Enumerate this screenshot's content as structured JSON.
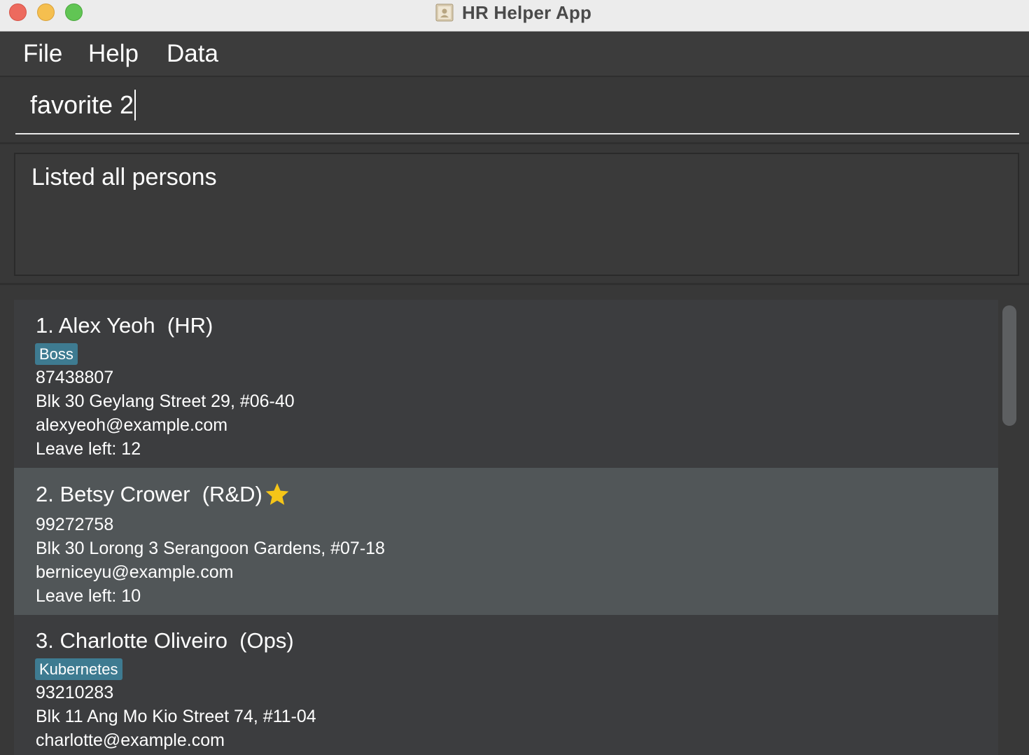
{
  "window": {
    "title": "HR Helper App"
  },
  "menu": {
    "items": [
      "File",
      "Help",
      "Data"
    ]
  },
  "command": {
    "value": "favorite 2"
  },
  "result": {
    "message": "Listed all persons"
  },
  "persons": [
    {
      "name": "1. Alex Yeoh  (HR)",
      "favorite": false,
      "tags": [
        "Boss"
      ],
      "phone": "87438807",
      "address": "Blk 30 Geylang Street 29, #06-40",
      "email": "alexyeoh@example.com",
      "leave": "Leave left: 12"
    },
    {
      "name": "2. Betsy Crower  (R&D)",
      "favorite": true,
      "tags": [],
      "phone": "99272758",
      "address": "Blk 30 Lorong 3 Serangoon Gardens, #07-18",
      "email": "berniceyu@example.com",
      "leave": "Leave left: 10"
    },
    {
      "name": "3. Charlotte Oliveiro  (Ops)",
      "favorite": false,
      "tags": [
        "Kubernetes"
      ],
      "phone": "93210283",
      "address": "Blk 11 Ang Mo Kio Street 74, #11-04",
      "email": "charlotte@example.com",
      "leave": ""
    }
  ],
  "colors": {
    "background": "#383838",
    "tag": "#3e7b91",
    "selected_card": "#515658",
    "star": "#f5c518"
  },
  "icons": {
    "favorite": "star-icon",
    "app": "contact-book-icon"
  }
}
